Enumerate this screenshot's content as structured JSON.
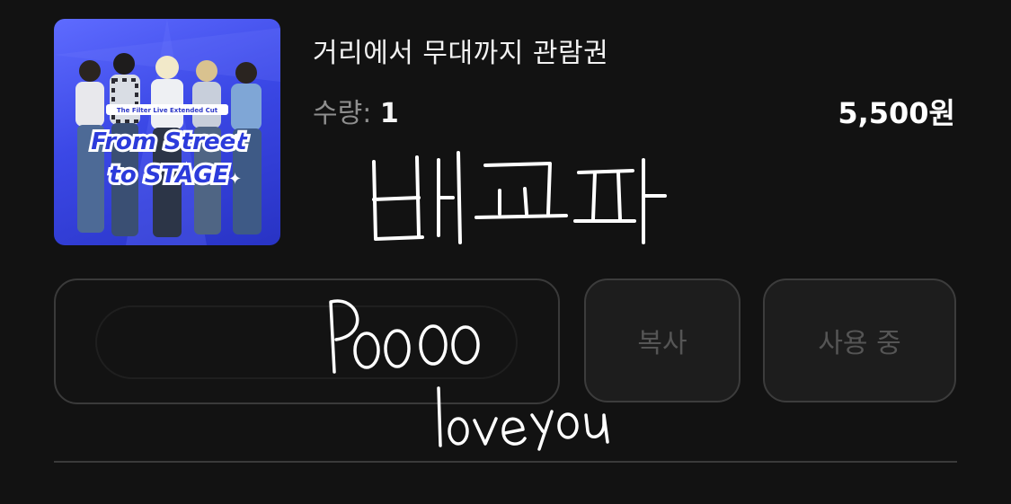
{
  "ticket": {
    "title": "거리에서 무대까지 관람권",
    "quantity_label": "수량:",
    "quantity_value": "1",
    "price": "5,500원",
    "thumbnail": {
      "subtitle": "The Filter Live Extended Cut",
      "line1": "From Street",
      "line2": "to STAGE"
    }
  },
  "actions": {
    "copy_label": "복사",
    "status_label": "사용 중"
  },
  "annotations": {
    "korean_handwriting": "배고파",
    "english_handwriting_1": "Poooo",
    "english_handwriting_2": "love you"
  },
  "colors": {
    "background": "#121212",
    "thumbnail_blue": "#3b48e6",
    "button_border": "#3c3c3c",
    "button_text": "#555555"
  }
}
